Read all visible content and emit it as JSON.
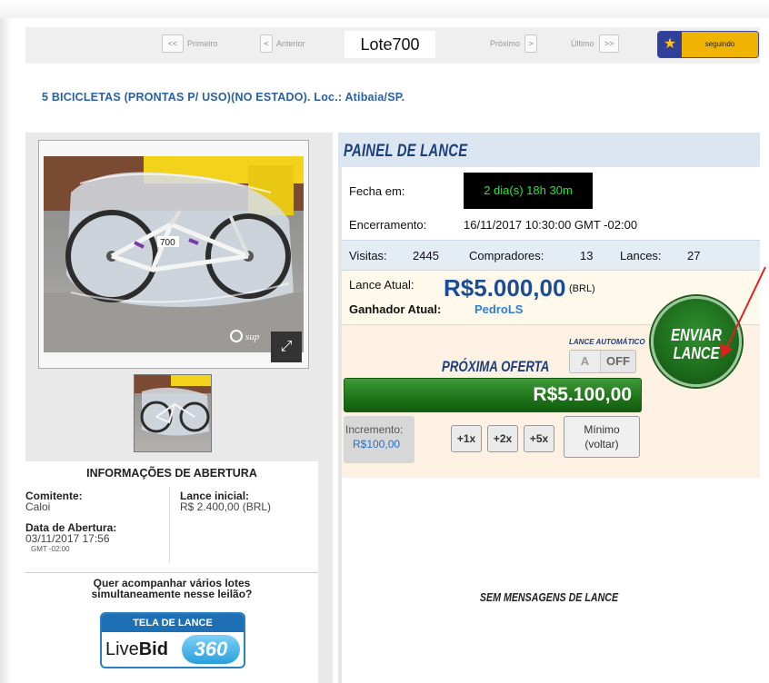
{
  "nav": {
    "first": "Primeiro",
    "previous": "Anterior",
    "lot": "Lote700",
    "next": "Próximo",
    "last": "Último",
    "follow": "seguindo"
  },
  "lot_title": "5 BICICLETAS (PRONTAS P/ USO)(NO ESTADO). Loc.: Atibaia/SP.",
  "gallery": {
    "watermark": "sup",
    "lot_tag": "700"
  },
  "opening_info": {
    "title": "INFORMAÇÕES DE ABERTURA",
    "consignor_label": "Comitente:",
    "consignor": "Caloi",
    "initial_bid_label": "Lance inicial:",
    "initial_bid": "R$ 2.400,00 (BRL)",
    "opening_date_label": "Data de Abertura:",
    "opening_date": "03/11/2017 17:56",
    "timezone": "GMT -02:00",
    "question_line1": "Quer acompanhar vários lotes",
    "question_line2": "simultaneamente nesse leilão?",
    "livebid_title": "TELA DE LANCE",
    "livebid_brand_regular": "Live",
    "livebid_brand_bold": "Bid",
    "livebid_number": "360"
  },
  "panel": {
    "title": "PAINEL DE LANCE",
    "closes_label": "Fecha em:",
    "countdown": "2 dia(s) 18h 30m",
    "closing_label": "Encerramento:",
    "closing_value": "16/11/2017 10:30:00  GMT -02:00",
    "visits_label": "Visitas:",
    "visits": "2445",
    "buyers_label": "Compradores:",
    "buyers": "13",
    "bids_label": "Lances:",
    "bids": "27",
    "current_bid_label": "Lance Atual:",
    "current_bid": "R$5.000,00",
    "currency": "(BRL)",
    "winner_label": "Ganhador Atual:",
    "winner": "PedroLS",
    "auto_bid_label": "LANCE AUTOMÁTICO",
    "auto_a": "A",
    "auto_off": "OFF",
    "next_offer_label": "PRÓXIMA OFERTA",
    "next_offer": "R$5.100,00",
    "increment_label": "Incremento:",
    "increment": "R$100,00",
    "mult_1": "+1x",
    "mult_2": "+2x",
    "mult_5": "+5x",
    "minimum_line1": "Mínimo",
    "minimum_line2": "(voltar)",
    "send_line1": "ENVIAR",
    "send_line2": "LANCE",
    "no_messages": "SEM MENSAGENS DE LANCE"
  },
  "colors": {
    "accent_blue": "#1c3f7c",
    "link_blue": "#2a7fd6",
    "countdown_green": "#22e83a",
    "bid_green": "#1e7318",
    "follow_yellow": "#f0b400",
    "arrow_red": "#e02020"
  }
}
